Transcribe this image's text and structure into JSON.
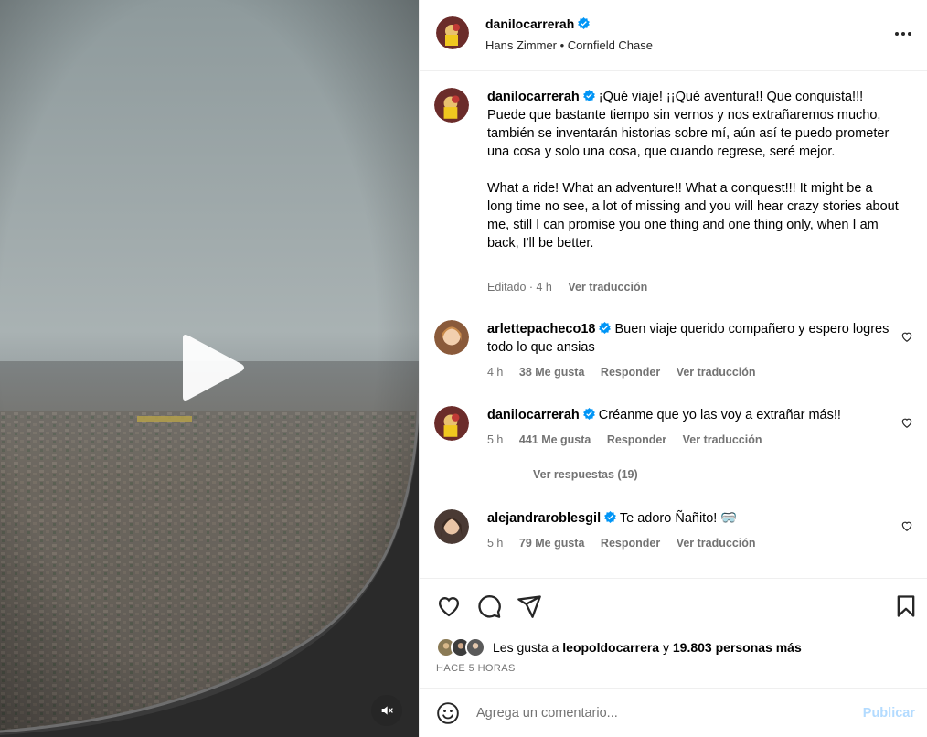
{
  "colors": {
    "accent": "#0095f6",
    "verified": "#0095f6",
    "muted_text": "#737373",
    "publish_disabled": "#b3dbff",
    "divider": "#efefef"
  },
  "media": {
    "play_icon": "play-icon",
    "mute_icon": "muted-speaker-icon"
  },
  "header": {
    "username": "danilocarrerah",
    "audio": "Hans Zimmer • Cornfield Chase",
    "more_icon": "more-options-icon"
  },
  "caption": {
    "username": "danilocarrerah",
    "text_es": "¡Qué viaje! ¡¡Qué aventura!! Que conquista!!! Puede que bastante tiempo sin vernos y nos extrañaremos mucho, también se inventarán historias sobre mí, aún así te puedo prometer una cosa y solo una cosa, que cuando regrese, seré mejor.",
    "text_en": "What a ride! What an adventure!! What a conquest!!! It might be a long time no see, a lot of missing and you will hear crazy stories about me, still I can promise you one thing and one thing only, when I am back, I'll be better.",
    "edited": "Editado · 4 h",
    "translate": "Ver traducción"
  },
  "comments": [
    {
      "username": "arlettepacheco18",
      "text": "Buen viaje querido compañero y espero logres todo lo que ansias",
      "time": "4 h",
      "likes": "38 Me gusta",
      "reply": "Responder",
      "translate": "Ver traducción"
    },
    {
      "username": "danilocarrerah",
      "text": "Créanme que yo las voy a extrañar más!!",
      "time": "5 h",
      "likes": "441 Me gusta",
      "reply": "Responder",
      "translate": "Ver traducción",
      "view_replies": "Ver respuestas (19)"
    },
    {
      "username": "alejandraroblesgil",
      "text": "Te adoro Ñañito! 🥽",
      "time": "5 h",
      "likes": "79 Me gusta",
      "reply": "Responder",
      "translate": "Ver traducción"
    }
  ],
  "actions": {
    "like_icon": "heart-icon",
    "comment_icon": "comment-icon",
    "share_icon": "share-icon",
    "save_icon": "bookmark-icon"
  },
  "likes": {
    "prefix": "Les gusta a",
    "user": "leopoldocarrera",
    "connector": "y",
    "others": "19.803 personas más"
  },
  "time_ago": "HACE 5 HORAS",
  "add_comment": {
    "placeholder": "Agrega un comentario...",
    "publish": "Publicar",
    "emoji_icon": "emoji-icon"
  }
}
